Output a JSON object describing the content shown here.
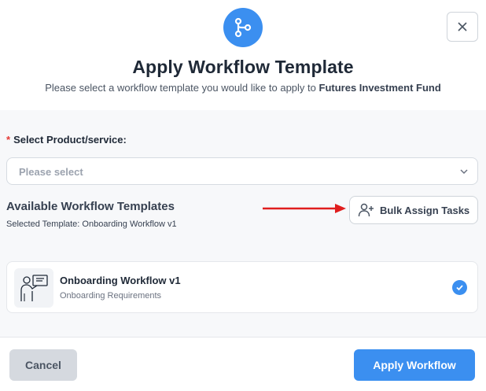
{
  "dialog": {
    "title": "Apply Workflow Template",
    "subtitle_prefix": "Please select a workflow template you would like to apply to ",
    "subtitle_target": "Futures Investment Fund",
    "header_icon": "workflow-branch-icon",
    "close_icon": "close-icon"
  },
  "product_field": {
    "required_mark": "*",
    "label": "Select Product/service:",
    "placeholder": "Please select",
    "icon": "chevron-down-icon"
  },
  "templates": {
    "section_title": "Available Workflow Templates",
    "selected_text": "Selected Template: Onboarding Workflow v1",
    "bulk_assign": {
      "label": "Bulk Assign Tasks",
      "icon": "user-plus-icon"
    },
    "items": [
      {
        "name": "Onboarding Workflow v1",
        "description": "Onboarding Requirements",
        "selected": true,
        "icon": "presenter-illustration-icon"
      }
    ]
  },
  "footer": {
    "cancel_label": "Cancel",
    "apply_label": "Apply Workflow"
  },
  "colors": {
    "accent": "#3b8ff0",
    "annotation_arrow": "#e01e1e",
    "required": "#e53935"
  }
}
